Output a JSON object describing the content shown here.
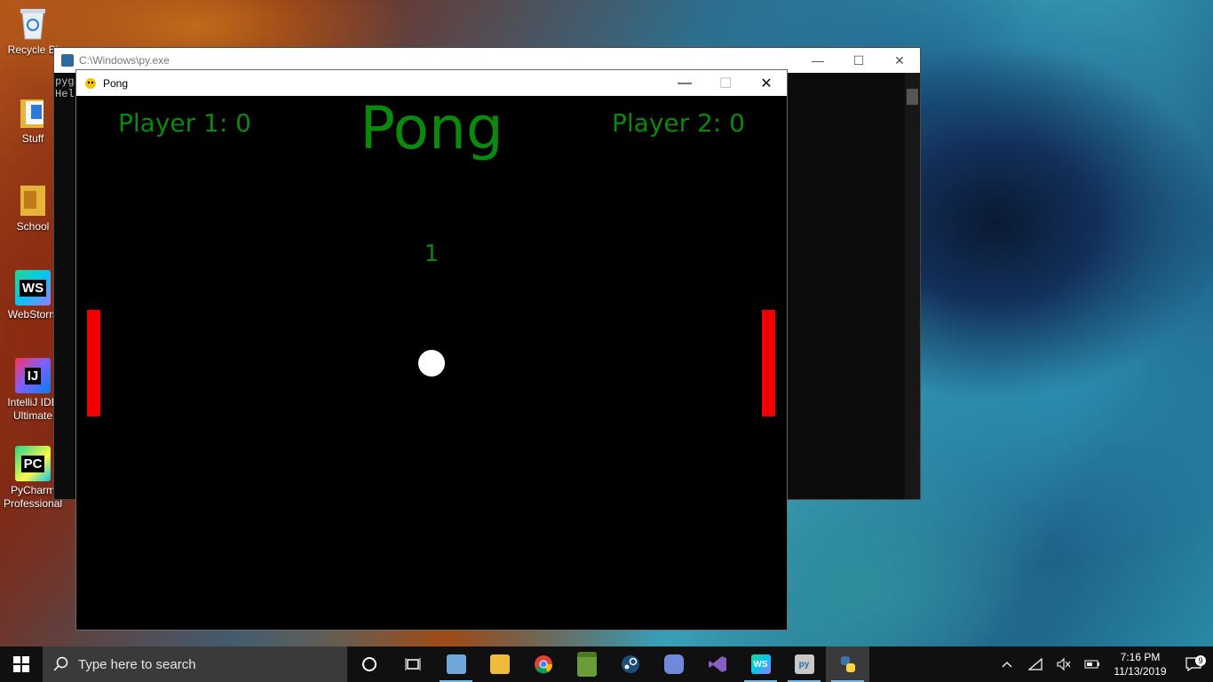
{
  "desktop": {
    "icons": [
      {
        "label": "Recycle Bi",
        "icon": "recycle-bin-icon"
      },
      {
        "label": "Stuff",
        "icon": "folder-icon"
      },
      {
        "label": "School",
        "icon": "folder-icon"
      },
      {
        "label": "WebStorm",
        "icon": "webstorm-icon",
        "badge": "WS"
      },
      {
        "label": "IntelliJ IDE Ultimate",
        "icon": "intellij-icon",
        "badge": "IJ"
      },
      {
        "label": "PyCharm Professional",
        "icon": "pycharm-icon",
        "badge": "PC"
      }
    ]
  },
  "console": {
    "title": "C:\\Windows\\py.exe",
    "lines": [
      "pyg",
      "Hel"
    ],
    "controls": {
      "minimize": "—",
      "maximize": "☐",
      "close": "✕"
    }
  },
  "pong_window": {
    "title": "Pong",
    "controls": {
      "minimize": "—",
      "maximize": "☐",
      "close": "✕"
    }
  },
  "game": {
    "title": "Pong",
    "player1_score": "Player 1: 0",
    "player2_score": "Player 2: 0",
    "countdown": "1",
    "colors": {
      "text": "#0a8a0a",
      "paddle": "#f20000",
      "ball": "#ffffff",
      "background": "#000000"
    }
  },
  "taskbar": {
    "search_placeholder": "Type here to search",
    "apps": [
      "cortana-icon",
      "task-view-icon",
      "control-panel-icon",
      "file-explorer-icon",
      "chrome-icon",
      "minecraft-icon",
      "steam-icon",
      "discord-icon",
      "visual-studio-icon",
      "webstorm-icon",
      "python-launcher-icon",
      "python-icon"
    ],
    "time": "7:16 PM",
    "date": "11/13/2019",
    "notifications": "9"
  }
}
